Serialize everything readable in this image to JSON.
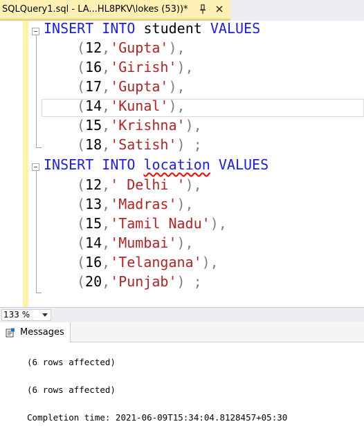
{
  "tab": {
    "title": "SQLQuery1.sql - LA...HL8PKV\\lokes (53))*"
  },
  "editor": {
    "statements": [
      {
        "kw1": "INSERT",
        "kw2": "INTO",
        "table": "student",
        "kw3": "VALUES",
        "table_misspelled": false,
        "rows": [
          {
            "num": "12",
            "text": "'Gupta'",
            "end": "),"
          },
          {
            "num": "16",
            "text": "'Girish'",
            "end": "),"
          },
          {
            "num": "17",
            "text": "'Gupta'",
            "end": "),"
          },
          {
            "num": "14",
            "text": "'Kunal'",
            "end": "),"
          },
          {
            "num": "15",
            "text": "'Krishna'",
            "end": "),"
          },
          {
            "num": "18",
            "text": "'Satish'",
            "end": ") ;"
          }
        ]
      },
      {
        "kw1": "INSERT",
        "kw2": "INTO",
        "table": "location",
        "kw3": "VALUES",
        "table_misspelled": true,
        "rows": [
          {
            "num": "12",
            "text": "' Delhi '",
            "end": "),"
          },
          {
            "num": "13",
            "text": "'Madras'",
            "end": "),"
          },
          {
            "num": "15",
            "text": "'Tamil Nadu'",
            "end": "),"
          },
          {
            "num": "14",
            "text": "'Mumbai'",
            "end": "),"
          },
          {
            "num": "16",
            "text": "'Telangana'",
            "end": "),"
          },
          {
            "num": "20",
            "text": "'Punjab'",
            "end": ") ;"
          }
        ]
      }
    ]
  },
  "zoom": {
    "value": "133 %"
  },
  "results": {
    "tab_label": "Messages",
    "messages": [
      "(6 rows affected)",
      "(6 rows affected)",
      "Completion time: 2021-06-09T15:34:04.8128457+05:30"
    ]
  },
  "colors": {
    "keyword": "#1c1ce8",
    "string": "#b62121",
    "tab_active": "#fff0b3",
    "margin": "#fff3a8"
  },
  "icons": {
    "pin": "pin-icon",
    "close": "close-icon",
    "zoom_dropdown": "chevron-down-icon",
    "messages": "messages-icon"
  }
}
